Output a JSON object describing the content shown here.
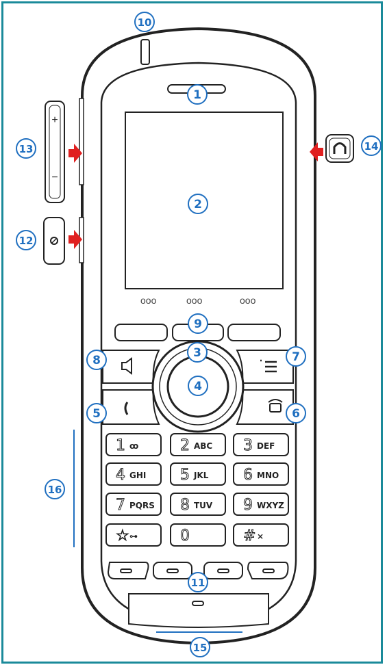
{
  "diagram": {
    "callouts": [
      {
        "id": "1",
        "label": "1"
      },
      {
        "id": "2",
        "label": "2"
      },
      {
        "id": "3",
        "label": "3"
      },
      {
        "id": "4",
        "label": "4"
      },
      {
        "id": "5",
        "label": "5"
      },
      {
        "id": "6",
        "label": "6"
      },
      {
        "id": "7",
        "label": "7"
      },
      {
        "id": "8",
        "label": "8"
      },
      {
        "id": "9",
        "label": "9"
      },
      {
        "id": "10",
        "label": "10"
      },
      {
        "id": "11",
        "label": "11"
      },
      {
        "id": "12",
        "label": "12"
      },
      {
        "id": "13",
        "label": "13"
      },
      {
        "id": "14",
        "label": "14"
      },
      {
        "id": "15",
        "label": "15"
      },
      {
        "id": "16",
        "label": "16"
      }
    ],
    "keypad": [
      {
        "digit": "1",
        "letters": "ꝏ"
      },
      {
        "digit": "2",
        "letters": "ABC"
      },
      {
        "digit": "3",
        "letters": "DEF"
      },
      {
        "digit": "4",
        "letters": "GHI"
      },
      {
        "digit": "5",
        "letters": "JKL"
      },
      {
        "digit": "6",
        "letters": "MNO"
      },
      {
        "digit": "7",
        "letters": "PQRS"
      },
      {
        "digit": "8",
        "letters": "TUV"
      },
      {
        "digit": "9",
        "letters": "WXYZ"
      },
      {
        "digit": "☆",
        "letters": "⊶"
      },
      {
        "digit": "0",
        "letters": ""
      },
      {
        "digit": "#",
        "letters": "⨯"
      }
    ],
    "dot_groups": [
      "ooo",
      "ooo",
      "ooo"
    ],
    "volume": {
      "plus": "+",
      "minus": "−"
    },
    "colors": {
      "callout": "#1f6fc0",
      "arrow": "#e02020",
      "frame": "#1a8a9a",
      "outline": "#222222"
    }
  }
}
